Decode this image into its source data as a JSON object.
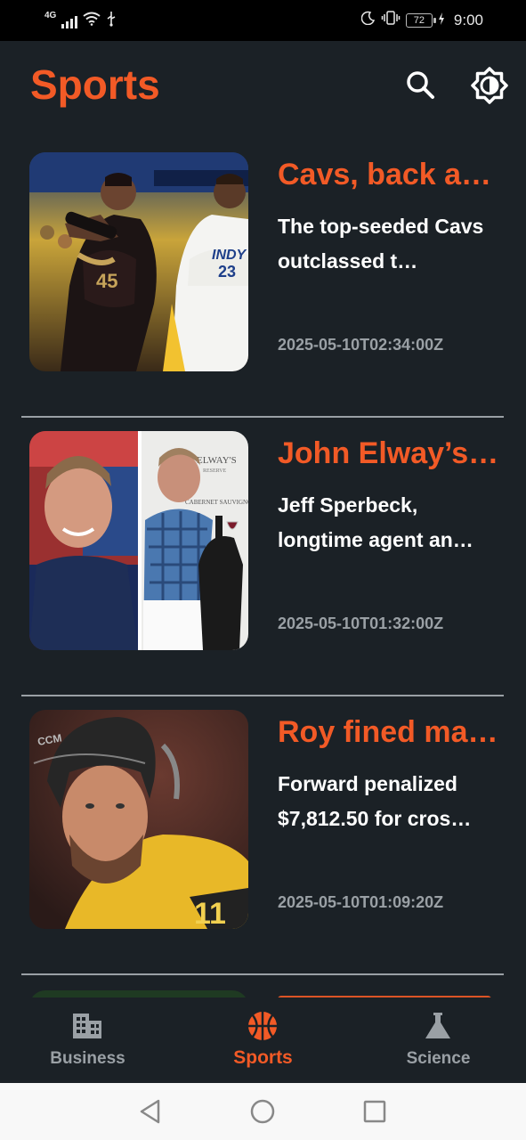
{
  "status_bar": {
    "network": "4G",
    "battery": "72",
    "time": "9:00"
  },
  "header": {
    "title": "Sports",
    "search_icon": "search-icon",
    "theme_icon": "brightness-icon"
  },
  "articles": [
    {
      "title": "Cavs, back at…",
      "description": "The top-seeded Cavs outclassed t…",
      "timestamp": "2025-05-10T02:34:00Z"
    },
    {
      "title": "John Elway’s …",
      "description": "Jeff Sperbeck, longtime agent an…",
      "timestamp": "2025-05-10T01:32:00Z"
    },
    {
      "title": "Roy fined ma…",
      "description": "Forward penalized $7,812.50 for cros…",
      "timestamp": "2025-05-10T01:09:20Z"
    }
  ],
  "image_text": {
    "jersey_cavs": "45",
    "jersey_pacers": "23",
    "pacers_text": "INDY",
    "wine_label": "ELWAY'S",
    "wine_sub": "RESERVE",
    "wine_variety": "CABERNET SAUVIGNON",
    "hockey_jersey": "11",
    "helmet_brand": "CCM"
  },
  "bottom_nav": {
    "items": [
      {
        "label": "Business",
        "icon": "building-icon",
        "active": false
      },
      {
        "label": "Sports",
        "icon": "basketball-icon",
        "active": true
      },
      {
        "label": "Science",
        "icon": "flask-icon",
        "active": false
      }
    ]
  },
  "colors": {
    "accent": "#f25a26",
    "background": "#1b2126",
    "muted": "#9aa0a5"
  }
}
